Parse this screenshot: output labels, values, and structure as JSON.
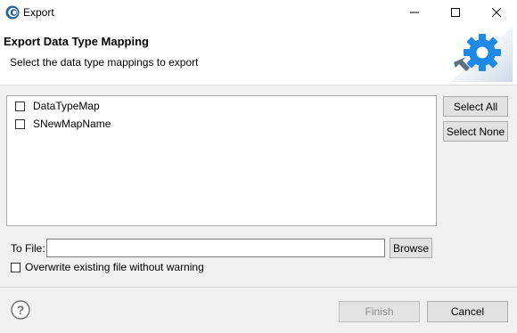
{
  "window": {
    "title": "Export"
  },
  "header": {
    "title": "Export Data Type Mapping",
    "description": "Select the data type mappings to export"
  },
  "mappings": {
    "items": [
      {
        "label": "DataTypeMap",
        "checked": false
      },
      {
        "label": "SNewMapName",
        "checked": false
      }
    ],
    "select_all_label": "Select All",
    "select_none_label": "Select None"
  },
  "file": {
    "label": "To File:",
    "value": "",
    "browse_label": "Browse",
    "overwrite_label": "Overwrite existing file without warning",
    "overwrite_checked": false
  },
  "footer": {
    "finish_label": "Finish",
    "cancel_label": "Cancel",
    "finish_enabled": false
  },
  "icons": {
    "app": "eclipse-app-icon",
    "wizard": "gear-export-icon",
    "help": "question-circle-icon"
  },
  "colors": {
    "gear_blue": "#1e8ae6",
    "app_icon_blue": "#1f5f9e"
  }
}
